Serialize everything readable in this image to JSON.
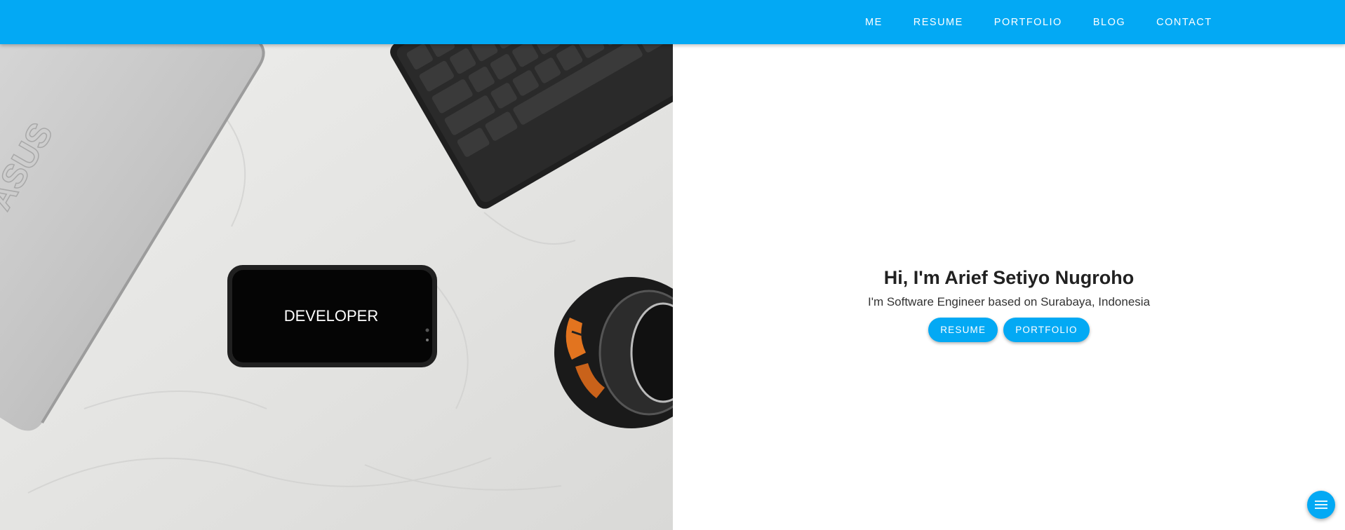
{
  "nav": {
    "items": [
      {
        "label": "ME"
      },
      {
        "label": "RESUME"
      },
      {
        "label": "PORTFOLIO"
      },
      {
        "label": "BLOG"
      },
      {
        "label": "CONTACT"
      }
    ]
  },
  "hero": {
    "phone_text": "DEVELOPER",
    "laptop_logo": "ASUS",
    "title": "Hi, I'm Arief Setiyo Nugroho",
    "subtitle": "I'm Software Engineer based on Surabaya, Indonesia",
    "buttons": {
      "resume": "RESUME",
      "portfolio": "PORTFOLIO"
    }
  },
  "fab": {
    "icon": "menu-icon"
  },
  "colors": {
    "accent": "#03a9f4",
    "title": "#212121",
    "text": "#333333"
  }
}
